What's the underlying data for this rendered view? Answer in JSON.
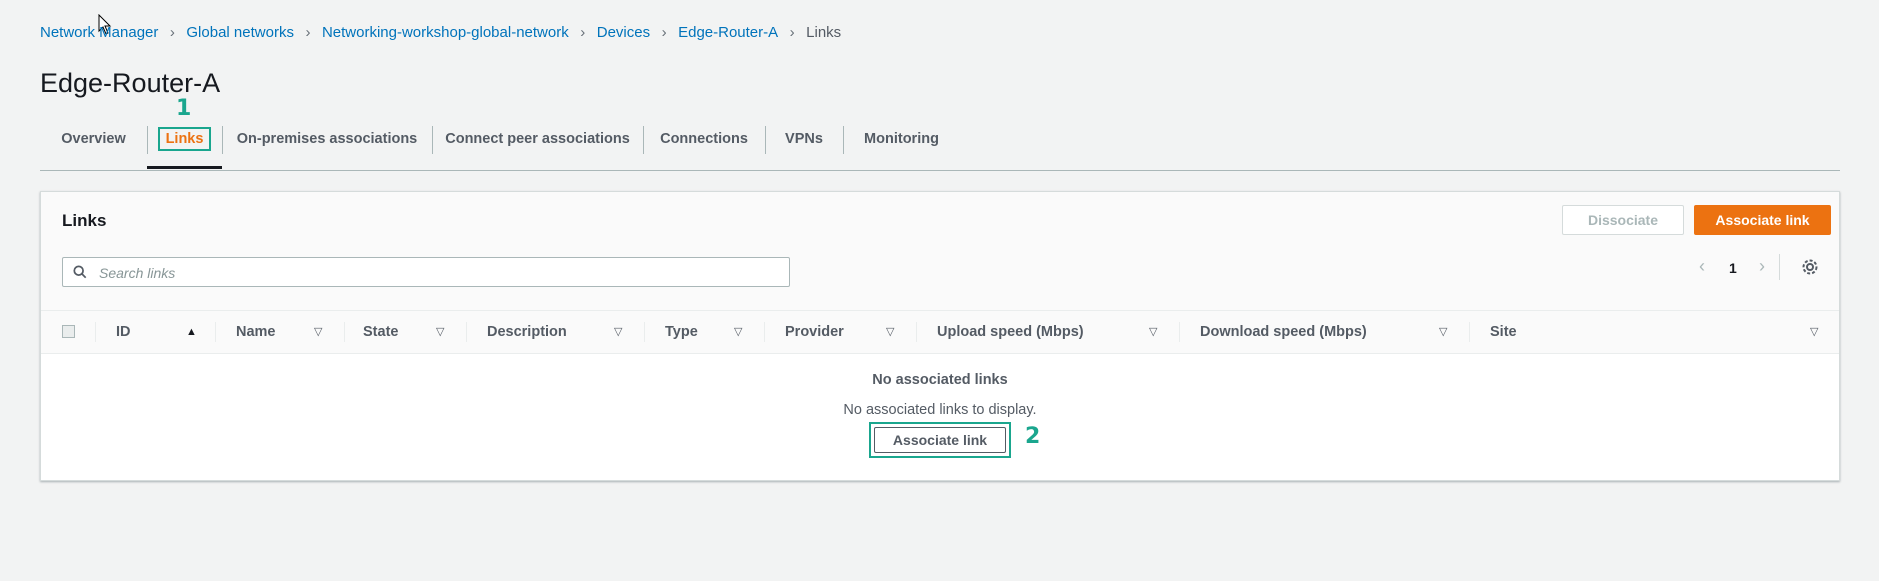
{
  "breadcrumb": [
    {
      "label": "Network Manager"
    },
    {
      "label": "Global networks"
    },
    {
      "label": "Networking-workshop-global-network"
    },
    {
      "label": "Devices"
    },
    {
      "label": "Edge-Router-A"
    },
    {
      "label": "Links"
    }
  ],
  "page": {
    "title": "Edge-Router-A"
  },
  "tabs": [
    {
      "label": "Overview"
    },
    {
      "label": "Links",
      "active": true
    },
    {
      "label": "On-premises associations"
    },
    {
      "label": "Connect peer associations"
    },
    {
      "label": "Connections"
    },
    {
      "label": "VPNs"
    },
    {
      "label": "Monitoring"
    }
  ],
  "callouts": {
    "first": "1",
    "second": "2"
  },
  "panel": {
    "title": "Links",
    "dissociate_label": "Dissociate",
    "associate_label": "Associate link",
    "search_placeholder": "Search links",
    "page_number": "1",
    "columns": [
      {
        "label": "ID"
      },
      {
        "label": "Name"
      },
      {
        "label": "State"
      },
      {
        "label": "Description"
      },
      {
        "label": "Type"
      },
      {
        "label": "Provider"
      },
      {
        "label": "Upload speed (Mbps)"
      },
      {
        "label": "Download speed (Mbps)"
      },
      {
        "label": "Site"
      }
    ],
    "empty_title": "No associated links",
    "empty_description": "No associated links to display.",
    "empty_button_label": "Associate link"
  },
  "colors": {
    "accent": "#ec7211",
    "link": "#0073bb",
    "highlight": "#1aa68e"
  }
}
